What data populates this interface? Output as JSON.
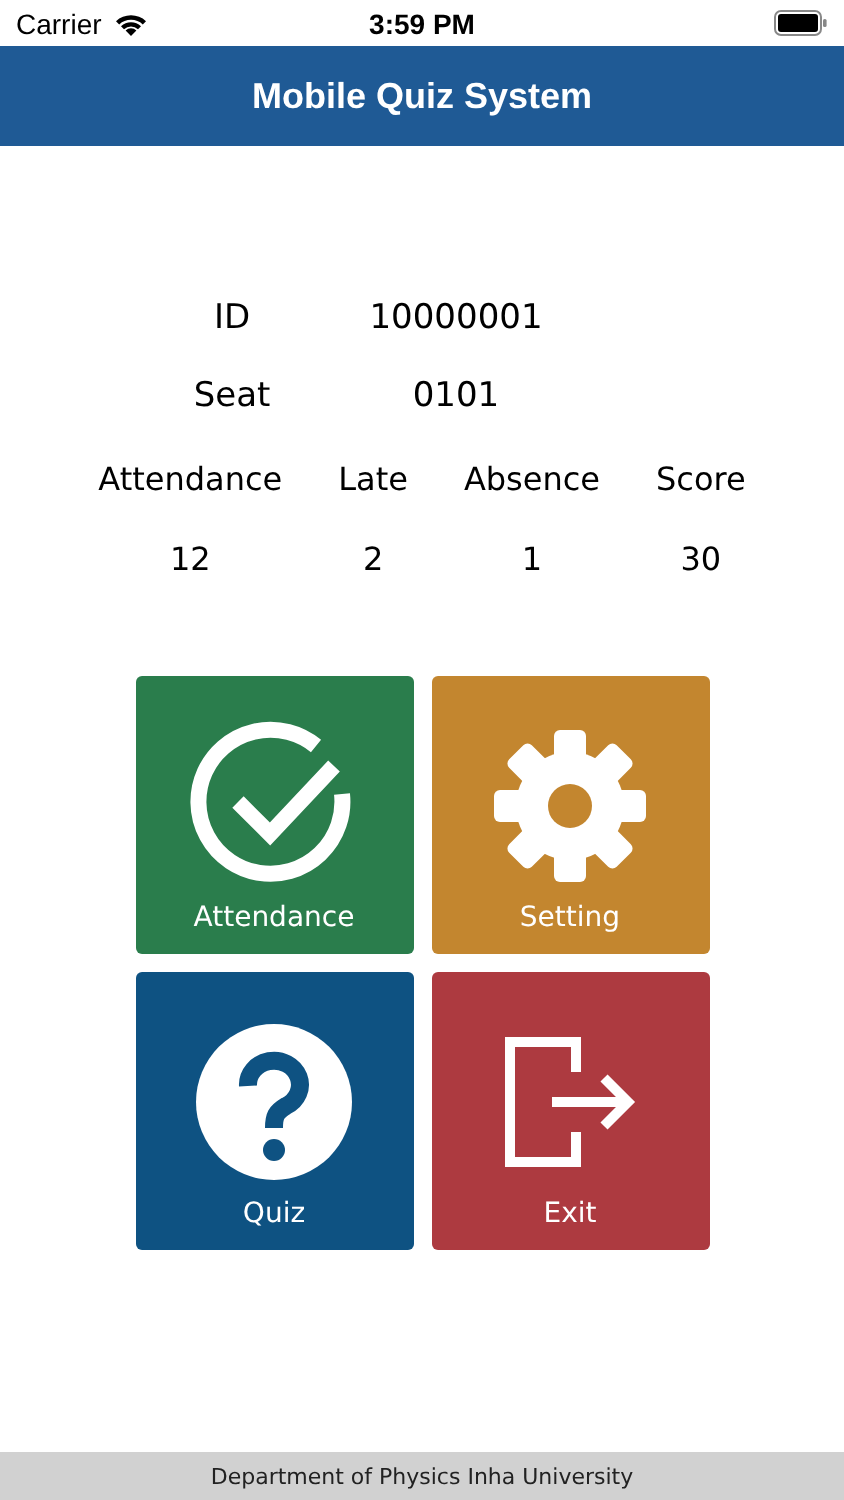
{
  "status_bar": {
    "carrier": "Carrier",
    "time": "3:59 PM"
  },
  "header": {
    "title": "Mobile Quiz System"
  },
  "info": [
    {
      "label": "ID",
      "value": "10000001"
    },
    {
      "label": "Seat",
      "value": "0101"
    }
  ],
  "stats": [
    {
      "label": "Attendance",
      "value": "12"
    },
    {
      "label": "Late",
      "value": "2"
    },
    {
      "label": "Absence",
      "value": "1"
    },
    {
      "label": "Score",
      "value": "30"
    }
  ],
  "tiles": [
    {
      "kind": "check",
      "label": "Attendance",
      "color": "#2a7d4c"
    },
    {
      "kind": "gear",
      "label": "Setting",
      "color": "#c3862f"
    },
    {
      "kind": "question",
      "label": "Quiz",
      "color": "#0e5282"
    },
    {
      "kind": "exit",
      "label": "Exit",
      "color": "#ad3a40"
    }
  ],
  "footer": {
    "text": "Department of Physics Inha University"
  }
}
